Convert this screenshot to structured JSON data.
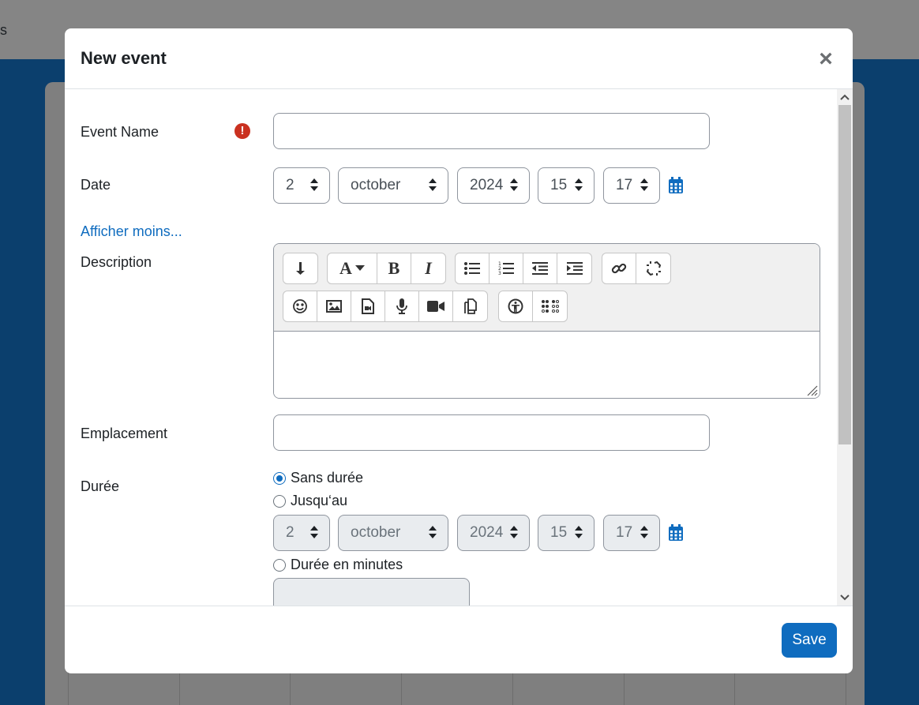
{
  "background": {
    "topbar_fragment": "s"
  },
  "modal": {
    "title": "New event",
    "close_icon": "×",
    "save_label": "Save"
  },
  "form": {
    "event_name": {
      "label": "Event Name",
      "value": "",
      "required_icon": "!"
    },
    "date": {
      "label": "Date",
      "day": "2",
      "month": "october",
      "year": "2024",
      "hour": "15",
      "minute": "17"
    },
    "show_less_link": "Afficher moins...",
    "description": {
      "label": "Description",
      "toolbar_row1": [
        "paragraph-style",
        "font-style",
        "bold",
        "italic",
        "unordered-list",
        "ordered-list",
        "outdent",
        "indent",
        "link",
        "unlink"
      ],
      "toolbar_row2": [
        "emoji",
        "image",
        "media",
        "record-audio",
        "record-video",
        "manage-files",
        "accessibility-checker",
        "screenreader-helper"
      ],
      "bold_glyph": "B",
      "italic_glyph": "I",
      "font_glyph": "A",
      "value": ""
    },
    "location": {
      "label": "Emplacement",
      "value": ""
    },
    "duration": {
      "label": "Durée",
      "options": [
        {
          "label": "Sans durée",
          "checked": true
        },
        {
          "label": "Jusqu‘au",
          "checked": false
        },
        {
          "label": "Durée en minutes",
          "checked": false
        }
      ],
      "until": {
        "day": "2",
        "month": "october",
        "year": "2024",
        "hour": "15",
        "minute": "17"
      },
      "minutes_value": ""
    }
  },
  "colors": {
    "primary": "#0f6cbf",
    "danger": "#ca3120",
    "backdrop_blue": "#0b3f6d"
  }
}
